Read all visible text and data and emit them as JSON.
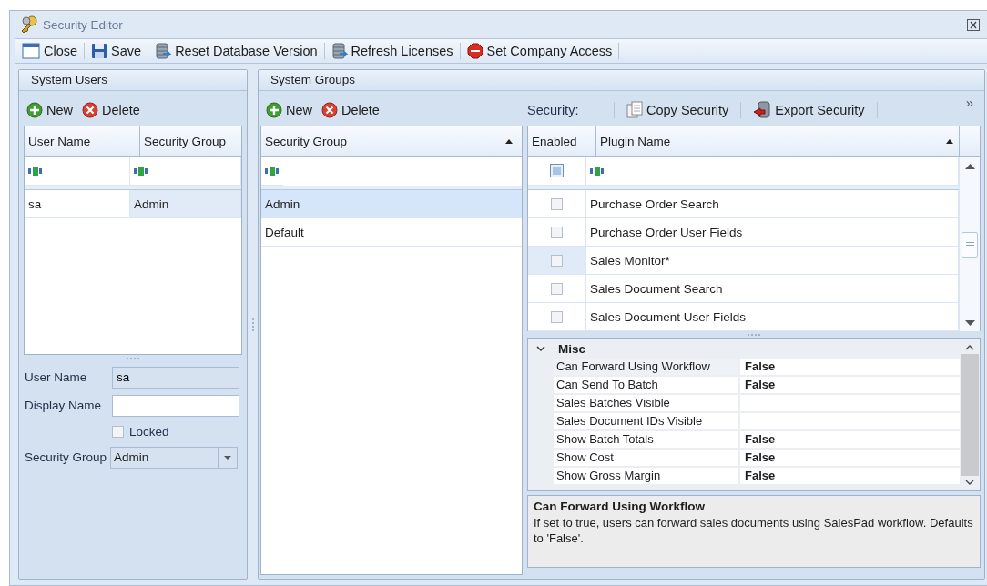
{
  "window": {
    "title": "Security Editor"
  },
  "toolbar": [
    {
      "label": "Close",
      "kind": "close"
    },
    {
      "label": "Save",
      "kind": "save"
    },
    {
      "label": "Reset Database Version",
      "kind": "database"
    },
    {
      "label": "Refresh Licenses",
      "kind": "database"
    },
    {
      "label": "Set Company Access",
      "kind": "stop"
    }
  ],
  "system_users": {
    "title": "System Users",
    "actions": [
      {
        "label": "New",
        "kind": "add"
      },
      {
        "label": "Delete",
        "kind": "delete"
      }
    ],
    "table": {
      "columns": [
        {
          "label": "User Name",
          "sorted": false
        },
        {
          "label": "Security Group",
          "sorted": false
        }
      ],
      "rows": [
        {
          "cells": [
            "sa",
            "Admin"
          ],
          "selected": true
        }
      ]
    },
    "form": {
      "user_name": {
        "label": "User Name",
        "value": "sa"
      },
      "display_name": {
        "label": "Display Name"
      },
      "locked": {
        "label": "Locked",
        "checked": false
      },
      "security_group": {
        "label": "Security Group",
        "value": "Admin"
      }
    }
  },
  "system_groups": {
    "title": "System Groups",
    "actions": [
      {
        "label": "New",
        "kind": "add"
      },
      {
        "label": "Delete",
        "kind": "delete"
      }
    ],
    "table": {
      "columns": [
        {
          "label": "Security Group",
          "sorted": true
        }
      ],
      "rows": [
        {
          "name": "Admin",
          "selected": true
        },
        {
          "name": "Default",
          "selected": false
        }
      ]
    }
  },
  "security": {
    "label": "Security:",
    "actions": [
      {
        "label": "Copy Security",
        "kind": "copy"
      },
      {
        "label": "Export Security",
        "kind": "export"
      }
    ],
    "overflow": "»",
    "plugins": {
      "filter": {
        "checked": true
      },
      "columns": [
        {
          "label": "Enabled",
          "sorted": false
        },
        {
          "label": "Plugin Name",
          "sorted": true
        }
      ],
      "rows": [
        {
          "name": "Purchase Order Search",
          "enabled": false,
          "selected": false
        },
        {
          "name": "Purchase Order User Fields",
          "enabled": false,
          "selected": false
        },
        {
          "name": "Sales Monitor*",
          "enabled": false,
          "selected": true
        },
        {
          "name": "Sales Document Search",
          "enabled": false,
          "selected": false
        },
        {
          "name": "Sales Document User Fields",
          "enabled": false,
          "selected": false
        }
      ]
    },
    "properties": {
      "category": "Misc",
      "expanded": true,
      "rows": [
        {
          "name": "Can Forward Using Workflow",
          "value": "False",
          "selected": true
        },
        {
          "name": "Can Send To Batch",
          "value": "False",
          "selected": false
        },
        {
          "name": "Sales Batches Visible",
          "selected": false
        },
        {
          "name": "Sales Document IDs Visible",
          "selected": false
        },
        {
          "name": "Show Batch Totals",
          "value": "False",
          "selected": false
        },
        {
          "name": "Show Cost",
          "value": "False",
          "selected": false
        },
        {
          "name": "Show Gross Margin",
          "value": "False",
          "selected": false
        }
      ]
    },
    "description": {
      "title": "Can Forward Using Workflow",
      "text": "If set to true, users can forward sales documents using SalesPad workflow. Defaults to 'False'."
    }
  }
}
